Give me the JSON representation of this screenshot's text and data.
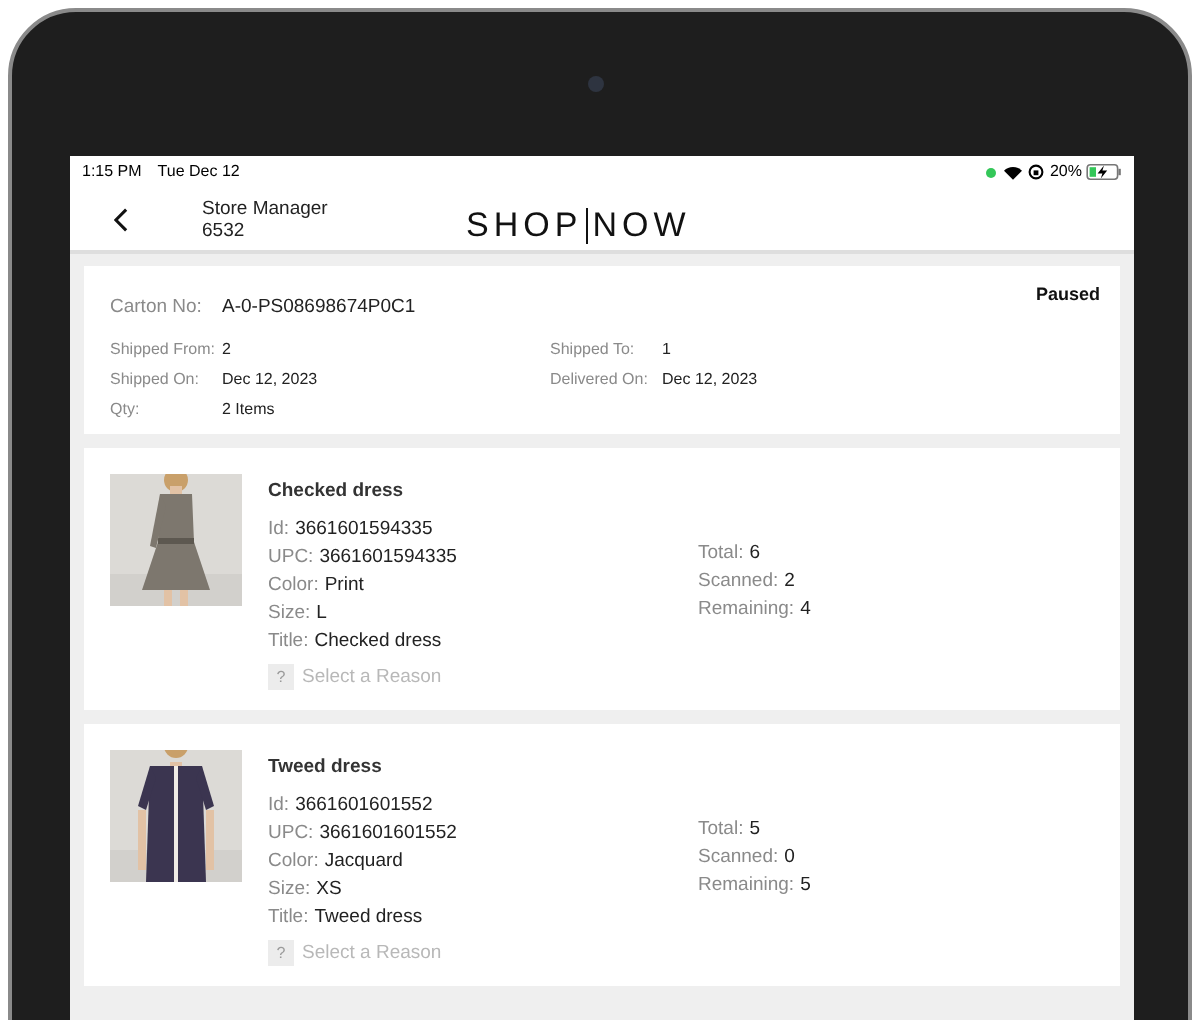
{
  "status_bar": {
    "time": "1:15 PM",
    "date": "Tue Dec 12",
    "battery": "20%"
  },
  "header": {
    "title": "Store Manager",
    "subtitle": "6532",
    "logo_left": "SHOP",
    "logo_right": "NOW"
  },
  "carton": {
    "status": "Paused",
    "number_label": "Carton No:",
    "number": "A-0-PS08698674P0C1",
    "details": [
      {
        "label": "Shipped From:",
        "value": "2"
      },
      {
        "label": "Shipped To:",
        "value": "1"
      },
      {
        "label": "Shipped On:",
        "value": "Dec 12, 2023"
      },
      {
        "label": "Delivered On:",
        "value": "Dec 12, 2023"
      },
      {
        "label": "Qty:",
        "value": "2 Items"
      }
    ]
  },
  "items": [
    {
      "name": "Checked dress",
      "kind": "checked",
      "fields": [
        {
          "label": "Id:",
          "value": "3661601594335"
        },
        {
          "label": "UPC:",
          "value": "3661601594335"
        },
        {
          "label": "Color:",
          "value": "Print"
        },
        {
          "label": "Size:",
          "value": "L"
        },
        {
          "label": "Title:",
          "value": "Checked dress"
        }
      ],
      "counts": [
        {
          "label": "Total:",
          "value": "6"
        },
        {
          "label": "Scanned:",
          "value": "2"
        },
        {
          "label": "Remaining:",
          "value": "4"
        }
      ],
      "reason": {
        "icon": "?",
        "label": "Select a Reason",
        "disabled": true
      }
    },
    {
      "name": "Tweed dress",
      "kind": "tweed",
      "fields": [
        {
          "label": "Id:",
          "value": "3661601601552"
        },
        {
          "label": "UPC:",
          "value": "3661601601552"
        },
        {
          "label": "Color:",
          "value": "Jacquard"
        },
        {
          "label": "Size:",
          "value": "XS"
        },
        {
          "label": "Title:",
          "value": "Tweed dress"
        }
      ],
      "counts": [
        {
          "label": "Total:",
          "value": "5"
        },
        {
          "label": "Scanned:",
          "value": "0"
        },
        {
          "label": "Remaining:",
          "value": "5"
        }
      ],
      "reason": {
        "icon": "?",
        "label": "Select a Reason",
        "disabled": true
      }
    }
  ]
}
